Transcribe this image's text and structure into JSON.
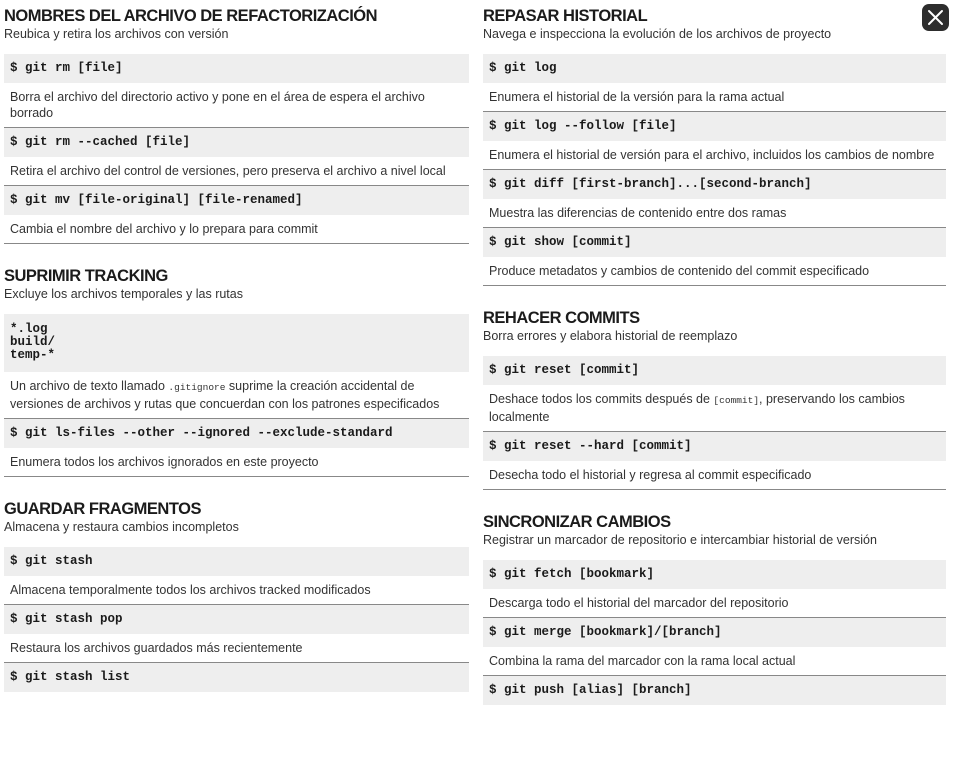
{
  "left": {
    "s1": {
      "title": "NOMBRES DEL ARCHIVO DE REFACTORIZACIÓN",
      "subtitle": "Reubica y retira los archivos con versión",
      "items": [
        {
          "cmd": "$ git rm [file]",
          "desc": "Borra el archivo del directorio activo y pone en el área de espera el archivo borrado"
        },
        {
          "cmd": "$ git rm --cached [file]",
          "desc": "Retira el archivo del control de versiones, pero preserva el archivo a nivel local"
        },
        {
          "cmd": "$ git mv [file-original] [file-renamed]",
          "desc": "Cambia el nombre del archivo y lo prepara para commit"
        }
      ]
    },
    "s2": {
      "title": "SUPRIMIR TRACKING",
      "subtitle": "Excluye los archivos temporales y las rutas",
      "code_block": "*.log\nbuild/\ntemp-*",
      "desc_pre": "Un archivo de texto llamado ",
      "desc_code": ".gitignore",
      "desc_post": "  suprime la creación accidental de versiones de archivos y rutas que concuerdan con los patrones especificados",
      "items": [
        {
          "cmd": "$ git ls-files --other --ignored --exclude-standard",
          "desc": "Enumera todos los archivos ignorados en este proyecto"
        }
      ]
    },
    "s3": {
      "title": "GUARDAR FRAGMENTOS",
      "subtitle": "Almacena y restaura cambios incompletos",
      "items": [
        {
          "cmd": "$ git stash",
          "desc": "Almacena temporalmente todos los archivos tracked modificados"
        },
        {
          "cmd": "$ git stash pop",
          "desc": "Restaura los archivos guardados más recientemente"
        },
        {
          "cmd": "$ git stash list"
        }
      ]
    }
  },
  "right": {
    "s1": {
      "title": "REPASAR HISTORIAL",
      "subtitle": "Navega e inspecciona la evolución de los archivos de proyecto",
      "items": [
        {
          "cmd": "$ git log",
          "desc": "Enumera el historial de la versión para la rama actual"
        },
        {
          "cmd": "$ git log --follow [file]",
          "desc": "Enumera el historial de versión para el archivo, incluidos los cambios de nombre"
        },
        {
          "cmd": "$ git diff [first-branch]...[second-branch]",
          "desc": "Muestra las diferencias de contenido entre dos ramas"
        },
        {
          "cmd": "$ git show [commit]",
          "desc": "Produce metadatos y cambios de contenido del commit especificado"
        }
      ]
    },
    "s2": {
      "title": "REHACER COMMITS",
      "subtitle": "Borra errores y elabora historial de reemplazo",
      "item1_cmd": "$ git reset [commit]",
      "item1_desc_pre": "Deshace todos los commits después de ",
      "item1_desc_code": "[commit]",
      "item1_desc_post": ", preservando los cambios localmente",
      "items": [
        {
          "cmd": "$ git reset --hard [commit]",
          "desc": "Desecha todo el historial y regresa al commit especificado"
        }
      ]
    },
    "s3": {
      "title": "SINCRONIZAR CAMBIOS",
      "subtitle": "Registrar un marcador de repositorio e intercambiar historial de versión",
      "items": [
        {
          "cmd": "$ git fetch [bookmark]",
          "desc": "Descarga todo el historial del marcador del repositorio"
        },
        {
          "cmd": "$ git merge [bookmark]/[branch]",
          "desc": "Combina la rama del marcador con la rama local actual"
        },
        {
          "cmd": "$ git push [alias] [branch]"
        }
      ]
    }
  },
  "close_icon": "close-icon"
}
